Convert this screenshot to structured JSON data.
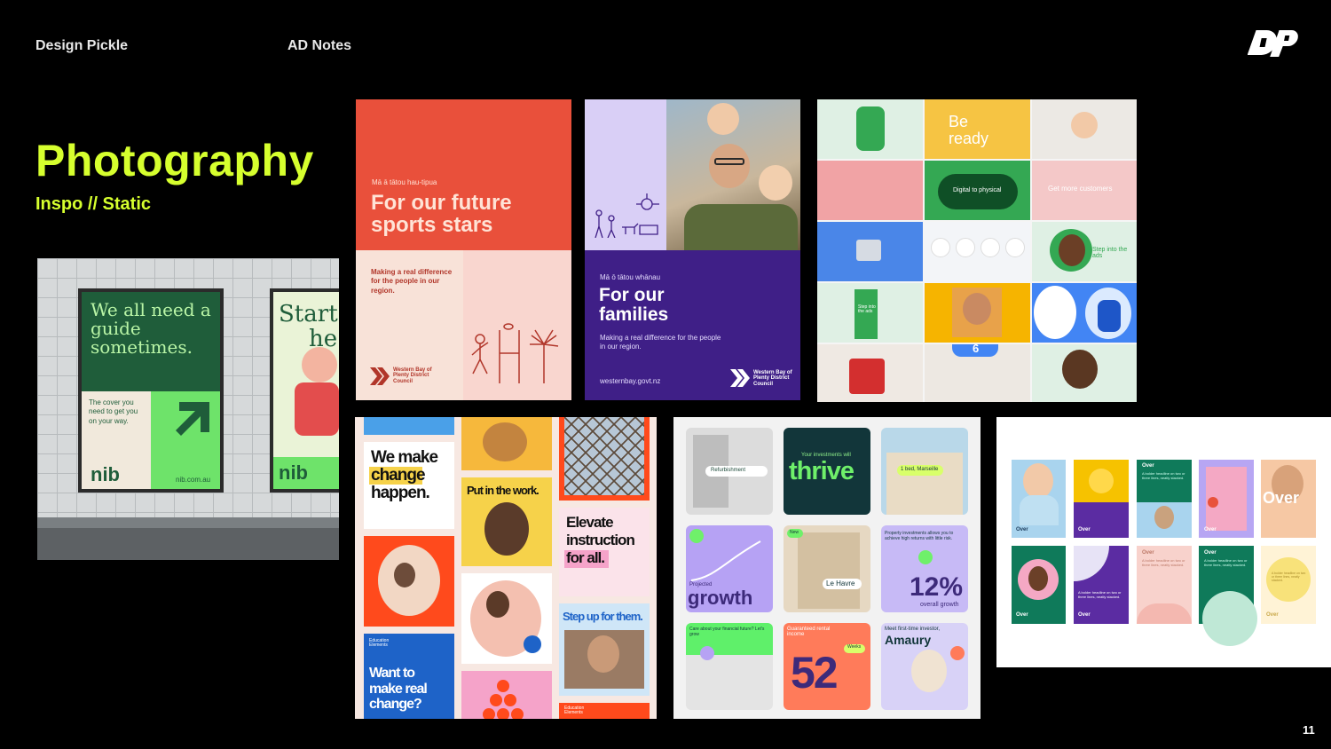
{
  "header": {
    "brand": "Design Pickle",
    "notes": "AD Notes",
    "logo": "DP"
  },
  "title": "Photography",
  "subtitle": "Inspo // Static",
  "page_number": "11",
  "nib": {
    "headline": "We all need a guide sometimes.",
    "body": "The cover you need to get you on your way.",
    "logo": "nib",
    "url": "nib.com.au",
    "poster2_headline_a": "Start",
    "poster2_headline_b": "he"
  },
  "wbop1": {
    "kicker": "Mā ā tātou hau-tipua",
    "headline": "For our future sports stars",
    "body": "Making a real difference for the people in our region.",
    "org": "Western Bay of Plenty District Council"
  },
  "wbop2": {
    "kicker": "Mā ō tātou whānau",
    "headline": "For our families",
    "body": "Making a real difference for the people in our region.",
    "url": "westernbay.govt.nz",
    "org": "Western Bay of Plenty District Council"
  },
  "google": {
    "be_ready": "Be ready",
    "digital": "Digital to physical",
    "customers": "Get more customers",
    "step": "Step into the ads",
    "step_green": "Step into the ads",
    "number": "6"
  },
  "edu": {
    "we_make_a": "We make",
    "change": "change",
    "happen": "happen.",
    "put_in": "Put in the work.",
    "elevate_a": "Elevate",
    "elevate_b": "instruction",
    "elevate_c": "for all.",
    "step_up": "Step up for them.",
    "want_to": "Want to make real change?",
    "org": "Education Elements"
  },
  "invest": {
    "refurb": "Refurbishment",
    "inv_will": "Your investments will",
    "thrive": "thrive",
    "marseille": "1 bed, Marseille",
    "projected": "Projected",
    "growth": "growth",
    "new": "New",
    "le_havre": "Le Havre",
    "property_text": "Property investments allows you to achieve high returns with little risk.",
    "pct": "12%",
    "overall": "overall growth",
    "care": "Care about your financial future? Let's grow",
    "guaranteed": "Guaranteed rental income",
    "n52": "52",
    "weeks": "Weeks",
    "meet": "Meet first-time investor,",
    "amaury": "Amaury"
  },
  "over": {
    "brand": "Over",
    "headline": "Over",
    "bolder": "A bolder headline on two or three lines, neatly stacked."
  },
  "colors": {
    "accent": "#d6ff2e",
    "nib_green": "#1f5d3a",
    "nib_lime": "#6ee36a",
    "wbop_red": "#e9503b",
    "wbop_purple": "#3f1f87"
  }
}
